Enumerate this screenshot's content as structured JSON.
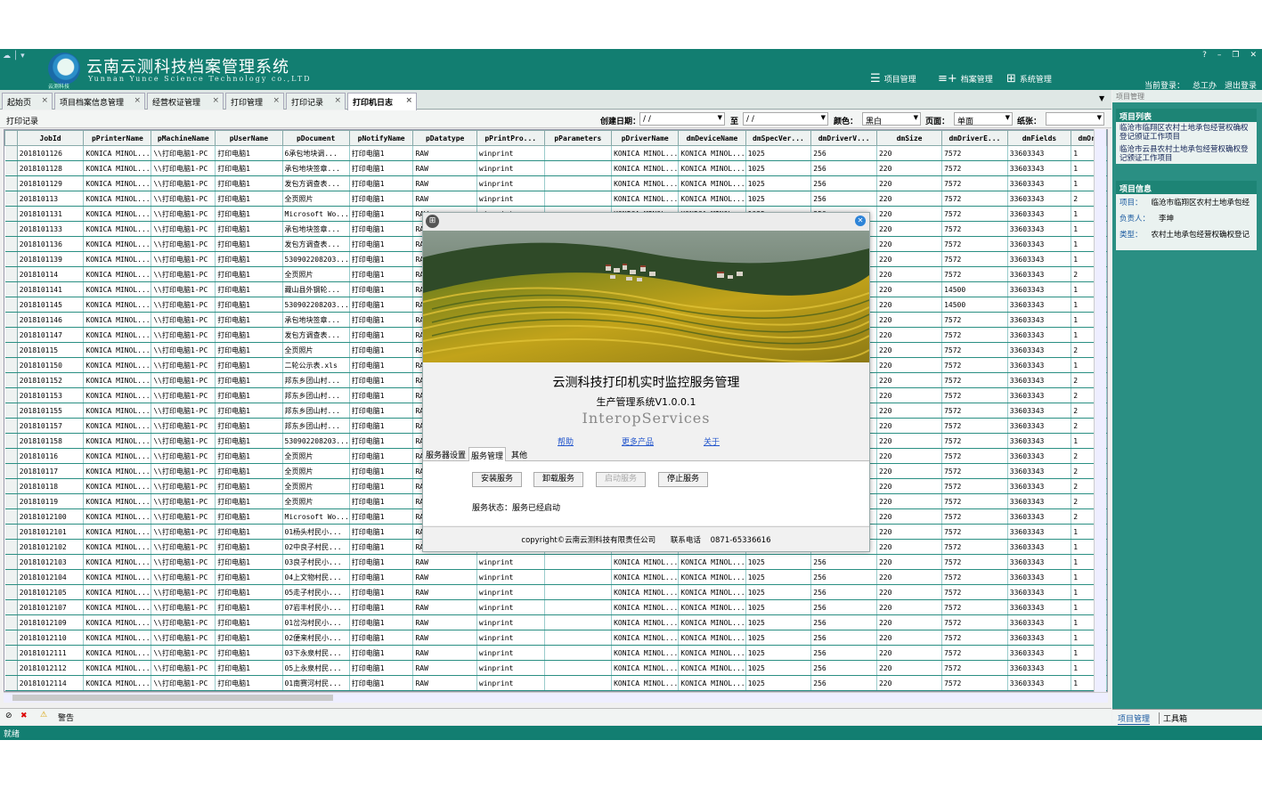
{
  "app": {
    "title": "云南云测科技档案管理系统",
    "subtitle": "Yunnan Yunce Science Technology co.,LTD",
    "logo_text": "云测科技",
    "nav": [
      {
        "label": "项目管理",
        "icon": "list-icon"
      },
      {
        "label": "档案管理",
        "icon": "add-list-icon"
      },
      {
        "label": "系统管理",
        "icon": "settings-grid-icon"
      }
    ],
    "current_login_label": "当前登录：",
    "current_user": "总工办",
    "logout": "退出登录",
    "window_buttons": [
      "?",
      "–",
      "❐",
      "✕"
    ]
  },
  "tabs": [
    {
      "label": "起始页"
    },
    {
      "label": "项目档案信息管理"
    },
    {
      "label": "经营权证管理"
    },
    {
      "label": "打印管理"
    },
    {
      "label": "打印记录"
    },
    {
      "label": "打印机日志",
      "active": true
    }
  ],
  "toolbar": {
    "section_title": "打印记录",
    "create_date_label": "创建日期：",
    "date_from": "/   /",
    "to_label": "至",
    "date_to": "/   /",
    "color_label": "颜色：",
    "color_value": "黑白",
    "page_label": "页面：",
    "page_value": "单面",
    "paper_label": "纸张：",
    "paper_value": ""
  },
  "grid": {
    "columns": [
      "JobId",
      "pPrinterName",
      "pMachineName",
      "pUserName",
      "pDocument",
      "pNotifyName",
      "pDatatype",
      "pPrintPro...",
      "pParameters",
      "pDriverName",
      "dmDeviceName",
      "dmSpecVer...",
      "dmDriverV...",
      "dmSize",
      "dmDriverE...",
      "dmFields",
      "dmOri"
    ],
    "rows": [
      [
        "2018101126",
        "KONICA MINOL...",
        "\\\\打印电脑1-PC",
        "打印电脑1",
        "6承包地块调...",
        "打印电脑1",
        "RAW",
        "winprint",
        "",
        "KONICA MINOL...",
        "KONICA MINOL...",
        "1025",
        "256",
        "220",
        "7572",
        "33603343",
        "1"
      ],
      [
        "2018101128",
        "KONICA MINOL...",
        "\\\\打印电脑1-PC",
        "打印电脑1",
        "承包地块签章...",
        "打印电脑1",
        "RAW",
        "winprint",
        "",
        "KONICA MINOL...",
        "KONICA MINOL...",
        "1025",
        "256",
        "220",
        "7572",
        "33603343",
        "1"
      ],
      [
        "2018101129",
        "KONICA MINOL...",
        "\\\\打印电脑1-PC",
        "打印电脑1",
        "发包方调查表...",
        "打印电脑1",
        "RAW",
        "winprint",
        "",
        "KONICA MINOL...",
        "KONICA MINOL...",
        "1025",
        "256",
        "220",
        "7572",
        "33603343",
        "1"
      ],
      [
        "201810113",
        "KONICA MINOL...",
        "\\\\打印电脑1-PC",
        "打印电脑1",
        "全页照片",
        "打印电脑1",
        "RAW",
        "winprint",
        "",
        "KONICA MINOL...",
        "KONICA MINOL...",
        "1025",
        "256",
        "220",
        "7572",
        "33603343",
        "2"
      ],
      [
        "2018101131",
        "KONICA MINOL...",
        "\\\\打印电脑1-PC",
        "打印电脑1",
        "Microsoft Wo...",
        "打印电脑1",
        "RAW",
        "winprint",
        "",
        "KONICA MINOL...",
        "KONICA MINOL...",
        "1025",
        "256",
        "220",
        "7572",
        "33603343",
        "1"
      ],
      [
        "2018101133",
        "KONICA MINOL...",
        "\\\\打印电脑1-PC",
        "打印电脑1",
        "承包地块签章...",
        "打印电脑1",
        "RA",
        "",
        "",
        "",
        "",
        "",
        "",
        "220",
        "7572",
        "33603343",
        "1"
      ],
      [
        "2018101136",
        "KONICA MINOL...",
        "\\\\打印电脑1-PC",
        "打印电脑1",
        "发包方调查表...",
        "打印电脑1",
        "RA",
        "",
        "",
        "",
        "",
        "",
        "",
        "220",
        "7572",
        "33603343",
        "1"
      ],
      [
        "2018101139",
        "KONICA MINOL...",
        "\\\\打印电脑1-PC",
        "打印电脑1",
        "530902208203...",
        "打印电脑1",
        "RA",
        "",
        "",
        "",
        "",
        "",
        "",
        "220",
        "7572",
        "33603343",
        "1"
      ],
      [
        "201810114",
        "KONICA MINOL...",
        "\\\\打印电脑1-PC",
        "打印电脑1",
        "全页照片",
        "打印电脑1",
        "RA",
        "",
        "",
        "",
        "",
        "",
        "",
        "220",
        "7572",
        "33603343",
        "2"
      ],
      [
        "2018101141",
        "KONICA MINOL...",
        "\\\\打印电脑1-PC",
        "打印电脑1",
        "藏山县外钢轮...",
        "打印电脑1",
        "RA",
        "",
        "",
        "",
        "",
        "",
        "",
        "220",
        "14500",
        "33603343",
        "1"
      ],
      [
        "2018101145",
        "KONICA MINOL...",
        "\\\\打印电脑1-PC",
        "打印电脑1",
        "530902208203...",
        "打印电脑1",
        "RA",
        "",
        "",
        "",
        "",
        "",
        "",
        "220",
        "14500",
        "33603343",
        "1"
      ],
      [
        "2018101146",
        "KONICA MINOL...",
        "\\\\打印电脑1-PC",
        "打印电脑1",
        "承包地块签章...",
        "打印电脑1",
        "RA",
        "",
        "",
        "",
        "",
        "",
        "",
        "220",
        "7572",
        "33603343",
        "1"
      ],
      [
        "2018101147",
        "KONICA MINOL...",
        "\\\\打印电脑1-PC",
        "打印电脑1",
        "发包方调查表...",
        "打印电脑1",
        "RA",
        "",
        "",
        "",
        "",
        "",
        "",
        "220",
        "7572",
        "33603343",
        "1"
      ],
      [
        "201810115",
        "KONICA MINOL...",
        "\\\\打印电脑1-PC",
        "打印电脑1",
        "全页照片",
        "打印电脑1",
        "RA",
        "",
        "",
        "",
        "",
        "",
        "",
        "220",
        "7572",
        "33603343",
        "2"
      ],
      [
        "2018101150",
        "KONICA MINOL...",
        "\\\\打印电脑1-PC",
        "打印电脑1",
        "二轮公示表.xls",
        "打印电脑1",
        "RA",
        "",
        "",
        "",
        "",
        "",
        "",
        "220",
        "7572",
        "33603343",
        "1"
      ],
      [
        "2018101152",
        "KONICA MINOL...",
        "\\\\打印电脑1-PC",
        "打印电脑1",
        "邦东乡团山村...",
        "打印电脑1",
        "RA",
        "",
        "",
        "",
        "",
        "",
        "",
        "220",
        "7572",
        "33603343",
        "2"
      ],
      [
        "2018101153",
        "KONICA MINOL...",
        "\\\\打印电脑1-PC",
        "打印电脑1",
        "邦东乡团山村...",
        "打印电脑1",
        "RA",
        "",
        "",
        "",
        "",
        "",
        "",
        "220",
        "7572",
        "33603343",
        "2"
      ],
      [
        "2018101155",
        "KONICA MINOL...",
        "\\\\打印电脑1-PC",
        "打印电脑1",
        "邦东乡团山村...",
        "打印电脑1",
        "RA",
        "",
        "",
        "",
        "",
        "",
        "",
        "220",
        "7572",
        "33603343",
        "2"
      ],
      [
        "2018101157",
        "KONICA MINOL...",
        "\\\\打印电脑1-PC",
        "打印电脑1",
        "邦东乡团山村...",
        "打印电脑1",
        "RA",
        "",
        "",
        "",
        "",
        "",
        "",
        "220",
        "7572",
        "33603343",
        "2"
      ],
      [
        "2018101158",
        "KONICA MINOL...",
        "\\\\打印电脑1-PC",
        "打印电脑1",
        "530902208203...",
        "打印电脑1",
        "RA",
        "",
        "",
        "",
        "",
        "",
        "",
        "220",
        "7572",
        "33603343",
        "1"
      ],
      [
        "201810116",
        "KONICA MINOL...",
        "\\\\打印电脑1-PC",
        "打印电脑1",
        "全页照片",
        "打印电脑1",
        "RA",
        "",
        "",
        "",
        "",
        "",
        "",
        "220",
        "7572",
        "33603343",
        "2"
      ],
      [
        "201810117",
        "KONICA MINOL...",
        "\\\\打印电脑1-PC",
        "打印电脑1",
        "全页照片",
        "打印电脑1",
        "RA",
        "",
        "",
        "",
        "",
        "",
        "",
        "220",
        "7572",
        "33603343",
        "2"
      ],
      [
        "201810118",
        "KONICA MINOL...",
        "\\\\打印电脑1-PC",
        "打印电脑1",
        "全页照片",
        "打印电脑1",
        "RA",
        "",
        "",
        "",
        "",
        "",
        "",
        "220",
        "7572",
        "33603343",
        "2"
      ],
      [
        "201810119",
        "KONICA MINOL...",
        "\\\\打印电脑1-PC",
        "打印电脑1",
        "全页照片",
        "打印电脑1",
        "RA",
        "",
        "",
        "",
        "",
        "",
        "",
        "220",
        "7572",
        "33603343",
        "2"
      ],
      [
        "20181012100",
        "KONICA MINOL...",
        "\\\\打印电脑1-PC",
        "打印电脑1",
        "Microsoft Wo...",
        "打印电脑1",
        "RA",
        "",
        "",
        "",
        "",
        "",
        "",
        "220",
        "7572",
        "33603343",
        "2"
      ],
      [
        "20181012101",
        "KONICA MINOL...",
        "\\\\打印电脑1-PC",
        "打印电脑1",
        "01杨头村民小...",
        "打印电脑1",
        "RA",
        "",
        "",
        "",
        "",
        "",
        "",
        "220",
        "7572",
        "33603343",
        "1"
      ],
      [
        "20181012102",
        "KONICA MINOL...",
        "\\\\打印电脑1-PC",
        "打印电脑1",
        "02中良子村民...",
        "打印电脑1",
        "RA",
        "",
        "",
        "",
        "",
        "",
        "",
        "220",
        "7572",
        "33603343",
        "1"
      ],
      [
        "20181012103",
        "KONICA MINOL...",
        "\\\\打印电脑1-PC",
        "打印电脑1",
        "03良子村民小...",
        "打印电脑1",
        "RAW",
        "winprint",
        "",
        "KONICA MINOL...",
        "KONICA MINOL...",
        "1025",
        "256",
        "220",
        "7572",
        "33603343",
        "1"
      ],
      [
        "20181012104",
        "KONICA MINOL...",
        "\\\\打印电脑1-PC",
        "打印电脑1",
        "04上文物村民...",
        "打印电脑1",
        "RAW",
        "winprint",
        "",
        "KONICA MINOL...",
        "KONICA MINOL...",
        "1025",
        "256",
        "220",
        "7572",
        "33603343",
        "1"
      ],
      [
        "20181012105",
        "KONICA MINOL...",
        "\\\\打印电脑1-PC",
        "打印电脑1",
        "05走子村民小...",
        "打印电脑1",
        "RAW",
        "winprint",
        "",
        "KONICA MINOL...",
        "KONICA MINOL...",
        "1025",
        "256",
        "220",
        "7572",
        "33603343",
        "1"
      ],
      [
        "20181012107",
        "KONICA MINOL...",
        "\\\\打印电脑1-PC",
        "打印电脑1",
        "07岩丰村民小...",
        "打印电脑1",
        "RAW",
        "winprint",
        "",
        "KONICA MINOL...",
        "KONICA MINOL...",
        "1025",
        "256",
        "220",
        "7572",
        "33603343",
        "1"
      ],
      [
        "20181012109",
        "KONICA MINOL...",
        "\\\\打印电脑1-PC",
        "打印电脑1",
        "01岔沟村民小...",
        "打印电脑1",
        "RAW",
        "winprint",
        "",
        "KONICA MINOL...",
        "KONICA MINOL...",
        "1025",
        "256",
        "220",
        "7572",
        "33603343",
        "1"
      ],
      [
        "20181012110",
        "KONICA MINOL...",
        "\\\\打印电脑1-PC",
        "打印电脑1",
        "02便来村民小...",
        "打印电脑1",
        "RAW",
        "winprint",
        "",
        "KONICA MINOL...",
        "KONICA MINOL...",
        "1025",
        "256",
        "220",
        "7572",
        "33603343",
        "1"
      ],
      [
        "20181012111",
        "KONICA MINOL...",
        "\\\\打印电脑1-PC",
        "打印电脑1",
        "03下永泉村民...",
        "打印电脑1",
        "RAW",
        "winprint",
        "",
        "KONICA MINOL...",
        "KONICA MINOL...",
        "1025",
        "256",
        "220",
        "7572",
        "33603343",
        "1"
      ],
      [
        "20181012112",
        "KONICA MINOL...",
        "\\\\打印电脑1-PC",
        "打印电脑1",
        "05上永泉村民...",
        "打印电脑1",
        "RAW",
        "winprint",
        "",
        "KONICA MINOL...",
        "KONICA MINOL...",
        "1025",
        "256",
        "220",
        "7572",
        "33603343",
        "1"
      ],
      [
        "20181012114",
        "KONICA MINOL...",
        "\\\\打印电脑1-PC",
        "打印电脑1",
        "01南赛河村民...",
        "打印电脑1",
        "RAW",
        "winprint",
        "",
        "KONICA MINOL...",
        "KONICA MINOL...",
        "1025",
        "256",
        "220",
        "7572",
        "33603343",
        "1"
      ]
    ]
  },
  "sidebar": {
    "header": "项目管理",
    "project_list_title": "项目列表",
    "projects": [
      "临沧市临翔区农村土地承包经营权确权登记颁证工作项目",
      "临沧市云县农村土地承包经营权确权登记颁证工作项目"
    ],
    "project_info_title": "项目信息",
    "info": [
      {
        "key": "项目：",
        "value": "临沧市临翔区农村土地承包经"
      },
      {
        "key": "负责人：",
        "value": "李坤"
      },
      {
        "key": "类型：",
        "value": "农村土地承包经营权确权登记"
      }
    ],
    "bottom_tabs": [
      "项目管理",
      "工具箱"
    ]
  },
  "warnbar": {
    "label": "警告"
  },
  "statusbar": {
    "text": "就绪"
  },
  "dialog": {
    "title": "云测科技打印机实时监控服务管理",
    "version": "生产管理系统V1.0.0.1",
    "interop": "InteropServices",
    "links": [
      "帮助",
      "更多产品",
      "关于"
    ],
    "tabs": [
      "服务器设置",
      "服务管理",
      "其他"
    ],
    "active_tab": "服务管理",
    "buttons": [
      {
        "label": "安装服务",
        "enabled": true
      },
      {
        "label": "卸载服务",
        "enabled": true
      },
      {
        "label": "启动服务",
        "enabled": false
      },
      {
        "label": "停止服务",
        "enabled": true
      }
    ],
    "status_label": "服务状态：",
    "status_value": "服务已经启动",
    "copyright": "copyright©云南云测科技有限责任公司",
    "phone_label": "联系电话",
    "phone": "0871-65336616"
  },
  "colors": {
    "brand": "#127e71",
    "grid_line": "#2a8f83",
    "link": "#2255cc"
  }
}
